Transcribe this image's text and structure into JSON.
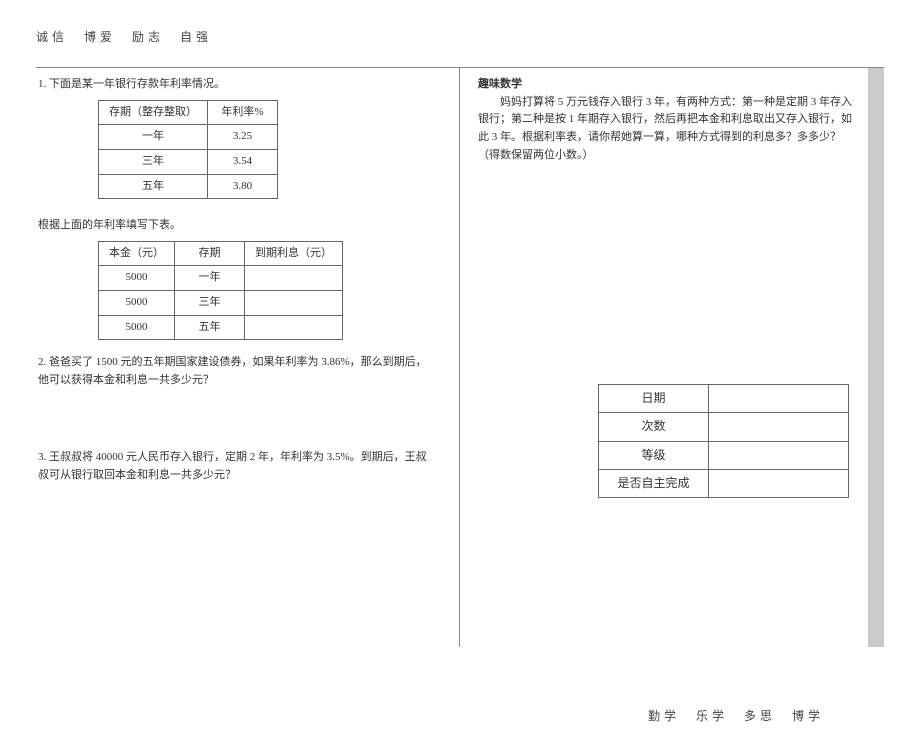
{
  "header_slogan": "诚信　博爱　励志　自强",
  "footer_slogan": "勤学　乐学　多思　博学",
  "left": {
    "q1": {
      "title": "1. 下面是某一年银行存款年利率情况。",
      "table1": {
        "head": [
          "存期（整存整取）",
          "年利率%"
        ],
        "rows": [
          [
            "一年",
            "3.25"
          ],
          [
            "三年",
            "3.54"
          ],
          [
            "五年",
            "3.80"
          ]
        ]
      },
      "subtext": "根据上面的年利率填写下表。",
      "table2": {
        "head": [
          "本金（元）",
          "存期",
          "到期利息（元）"
        ],
        "rows": [
          [
            "5000",
            "一年",
            ""
          ],
          [
            "5000",
            "三年",
            ""
          ],
          [
            "5000",
            "五年",
            ""
          ]
        ]
      }
    },
    "q2": "2. 爸爸买了 1500 元的五年期国家建设债券，如果年利率为 3.86%，那么到期后，他可以获得本金和利息一共多少元？",
    "q3": "3. 王叔叔将 40000 元人民币存入银行，定期 2 年，年利率为 3.5%。到期后，王叔叔可从银行取回本金和利息一共多少元？"
  },
  "right": {
    "fun_title": "趣味数学",
    "body": "妈妈打算将 5 万元钱存入银行 3 年，有两种方式：第一种是定期 3 年存入银行；第二种是按 1 年期存入银行，然后再把本金和利息取出又存入银行，如此 3 年。根据利率表，请你帮她算一算，哪种方式得到的利息多？多多少？（得数保留两位小数。）",
    "record": {
      "rows": [
        "日期",
        "次数",
        "等级",
        "是否自主完成"
      ]
    }
  }
}
